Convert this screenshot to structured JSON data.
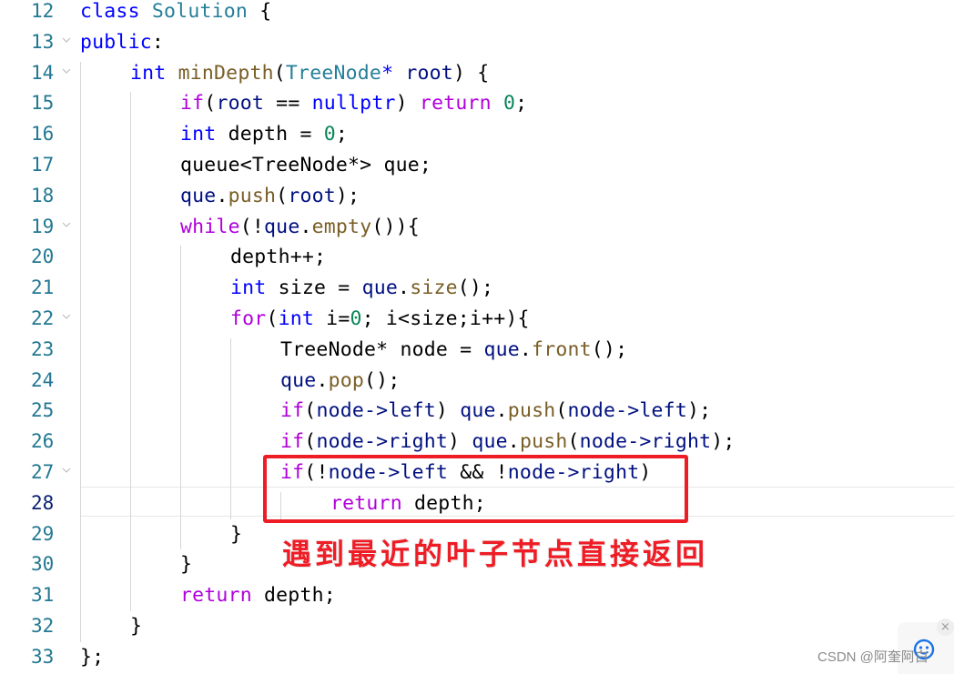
{
  "editor": {
    "active_line": 28,
    "lines": [
      {
        "num": "12",
        "indent": 0,
        "fold": false,
        "tokens": [
          [
            "kw",
            "class"
          ],
          [
            "",
            " "
          ],
          [
            "ty",
            "Solution"
          ],
          [
            "",
            " {"
          ]
        ]
      },
      {
        "num": "13",
        "indent": 0,
        "fold": true,
        "tokens": [
          [
            "kw",
            "public"
          ],
          [
            "",
            ":"
          ]
        ]
      },
      {
        "num": "14",
        "indent": 1,
        "fold": true,
        "tokens": [
          [
            "kw",
            "int"
          ],
          [
            "",
            " "
          ],
          [
            "fn",
            "minDepth"
          ],
          [
            "",
            "("
          ],
          [
            "ty",
            "TreeNode"
          ],
          [
            "kw",
            "*"
          ],
          [
            "",
            " "
          ],
          [
            "var",
            "root"
          ],
          [
            "",
            ") {"
          ]
        ]
      },
      {
        "num": "15",
        "indent": 2,
        "fold": false,
        "tokens": [
          [
            "ctl",
            "if"
          ],
          [
            "",
            "("
          ],
          [
            "var",
            "root"
          ],
          [
            "",
            " == "
          ],
          [
            "kw",
            "nullptr"
          ],
          [
            "",
            ") "
          ],
          [
            "ctl",
            "return"
          ],
          [
            "",
            " "
          ],
          [
            "num",
            "0"
          ],
          [
            "",
            ";"
          ]
        ]
      },
      {
        "num": "16",
        "indent": 2,
        "fold": false,
        "tokens": [
          [
            "kw",
            "int"
          ],
          [
            "",
            " depth = "
          ],
          [
            "num",
            "0"
          ],
          [
            "",
            ";"
          ]
        ]
      },
      {
        "num": "17",
        "indent": 2,
        "fold": false,
        "tokens": [
          [
            "",
            "queue<TreeNode*> que;"
          ]
        ]
      },
      {
        "num": "18",
        "indent": 2,
        "fold": false,
        "tokens": [
          [
            "var",
            "que"
          ],
          [
            "",
            "."
          ],
          [
            "fn",
            "push"
          ],
          [
            "",
            "("
          ],
          [
            "var",
            "root"
          ],
          [
            "",
            ");"
          ]
        ]
      },
      {
        "num": "19",
        "indent": 2,
        "fold": true,
        "tokens": [
          [
            "ctl",
            "while"
          ],
          [
            "",
            "(!"
          ],
          [
            "var",
            "que"
          ],
          [
            "",
            "."
          ],
          [
            "fn",
            "empty"
          ],
          [
            "",
            "()){"
          ]
        ]
      },
      {
        "num": "20",
        "indent": 3,
        "fold": false,
        "tokens": [
          [
            "",
            "depth++;"
          ]
        ]
      },
      {
        "num": "21",
        "indent": 3,
        "fold": false,
        "tokens": [
          [
            "kw",
            "int"
          ],
          [
            "",
            " size = "
          ],
          [
            "var",
            "que"
          ],
          [
            "",
            "."
          ],
          [
            "fn",
            "size"
          ],
          [
            "",
            "();"
          ]
        ]
      },
      {
        "num": "22",
        "indent": 3,
        "fold": true,
        "tokens": [
          [
            "ctl",
            "for"
          ],
          [
            "",
            "("
          ],
          [
            "kw",
            "int"
          ],
          [
            "",
            " i="
          ],
          [
            "num",
            "0"
          ],
          [
            "",
            "; i<size;i++){"
          ]
        ]
      },
      {
        "num": "23",
        "indent": 4,
        "fold": false,
        "tokens": [
          [
            "",
            "TreeNode* node = "
          ],
          [
            "var",
            "que"
          ],
          [
            "",
            "."
          ],
          [
            "fn",
            "front"
          ],
          [
            "",
            "();"
          ]
        ]
      },
      {
        "num": "24",
        "indent": 4,
        "fold": false,
        "tokens": [
          [
            "var",
            "que"
          ],
          [
            "",
            "."
          ],
          [
            "fn",
            "pop"
          ],
          [
            "",
            "();"
          ]
        ]
      },
      {
        "num": "25",
        "indent": 4,
        "fold": false,
        "tokens": [
          [
            "ctl",
            "if"
          ],
          [
            "",
            "("
          ],
          [
            "var",
            "node->left"
          ],
          [
            "",
            ") "
          ],
          [
            "var",
            "que"
          ],
          [
            "",
            "."
          ],
          [
            "fn",
            "push"
          ],
          [
            "",
            "("
          ],
          [
            "var",
            "node->left"
          ],
          [
            "",
            ");"
          ]
        ]
      },
      {
        "num": "26",
        "indent": 4,
        "fold": false,
        "tokens": [
          [
            "ctl",
            "if"
          ],
          [
            "",
            "("
          ],
          [
            "var",
            "node->right"
          ],
          [
            "",
            ") "
          ],
          [
            "var",
            "que"
          ],
          [
            "",
            "."
          ],
          [
            "fn",
            "push"
          ],
          [
            "",
            "("
          ],
          [
            "var",
            "node->right"
          ],
          [
            "",
            ");"
          ]
        ]
      },
      {
        "num": "27",
        "indent": 4,
        "fold": true,
        "tokens": [
          [
            "ctl",
            "if"
          ],
          [
            "",
            "(!"
          ],
          [
            "var",
            "node->left"
          ],
          [
            "",
            " && !"
          ],
          [
            "var",
            "node->right"
          ],
          [
            "",
            ")"
          ]
        ]
      },
      {
        "num": "28",
        "indent": 5,
        "fold": false,
        "tokens": [
          [
            "ctl",
            "return"
          ],
          [
            "",
            " depth;"
          ]
        ]
      },
      {
        "num": "29",
        "indent": 3,
        "fold": false,
        "tokens": [
          [
            "",
            "}"
          ]
        ]
      },
      {
        "num": "30",
        "indent": 2,
        "fold": false,
        "tokens": [
          [
            "",
            "}"
          ]
        ]
      },
      {
        "num": "31",
        "indent": 2,
        "fold": false,
        "tokens": [
          [
            "ctl",
            "return"
          ],
          [
            "",
            " depth;"
          ]
        ]
      },
      {
        "num": "32",
        "indent": 1,
        "fold": false,
        "tokens": [
          [
            "",
            "}"
          ]
        ]
      },
      {
        "num": "33",
        "indent": 0,
        "fold": false,
        "tokens": [
          [
            "",
            "};"
          ]
        ]
      }
    ]
  },
  "annotation": {
    "text": "遇到最近的叶子节点直接返回",
    "color": "#ee1c25"
  },
  "watermark": "CSDN @阿奎阿白",
  "widget": {
    "icon": "smiley-icon",
    "close_label": "×"
  }
}
